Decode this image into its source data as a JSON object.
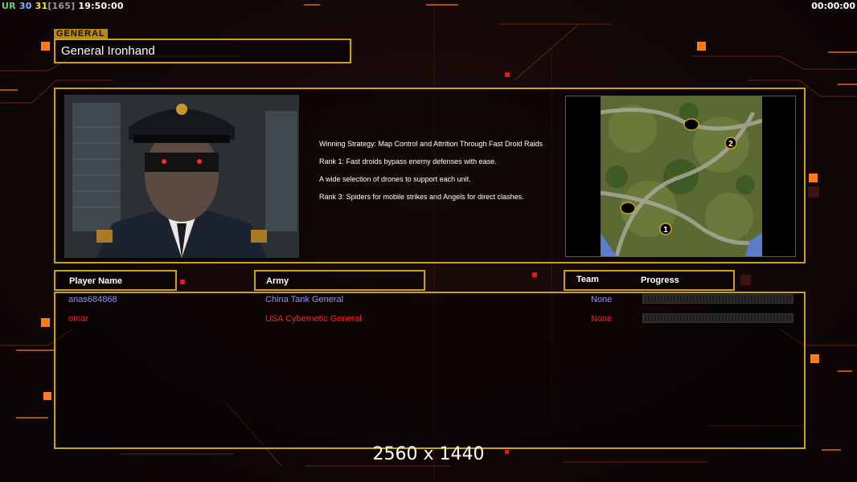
{
  "status_bar": {
    "ur_label": "UR",
    "val1": "30",
    "val2": "31",
    "val3": "[165]",
    "clock": "19:50:00",
    "timer": "00:00:00"
  },
  "general": {
    "tag": "GENERAL",
    "name": "General Ironhand"
  },
  "strategy_lines": [
    "Winning Strategy: Map Control and Attrition Through Fast Droid Raids",
    "Rank 1: Fast droids bypass enemy defenses with ease.",
    "A wide selection of drones to support each unit.",
    "Rank 3: Spiders for mobile strikes and Angels for direct clashes."
  ],
  "minimap": {
    "markers": [
      "1",
      "2"
    ]
  },
  "table": {
    "headers": {
      "player_name": "Player Name",
      "army": "Army",
      "team": "Team",
      "progress": "Progress"
    },
    "rows": [
      {
        "player": "anas684868",
        "army": "China Tank General",
        "team": "None",
        "color": "#8f8fff",
        "progress": 0
      },
      {
        "player": "omar",
        "army": "USA Cybernetic General",
        "team": "None",
        "color": "#ff1e1e",
        "progress": 0
      }
    ]
  },
  "resolution_label": "2560 x 1440",
  "colors": {
    "accent_gold": "#c9a21a",
    "background": "#0f0606",
    "orange_glow": "#ff7a1a"
  }
}
